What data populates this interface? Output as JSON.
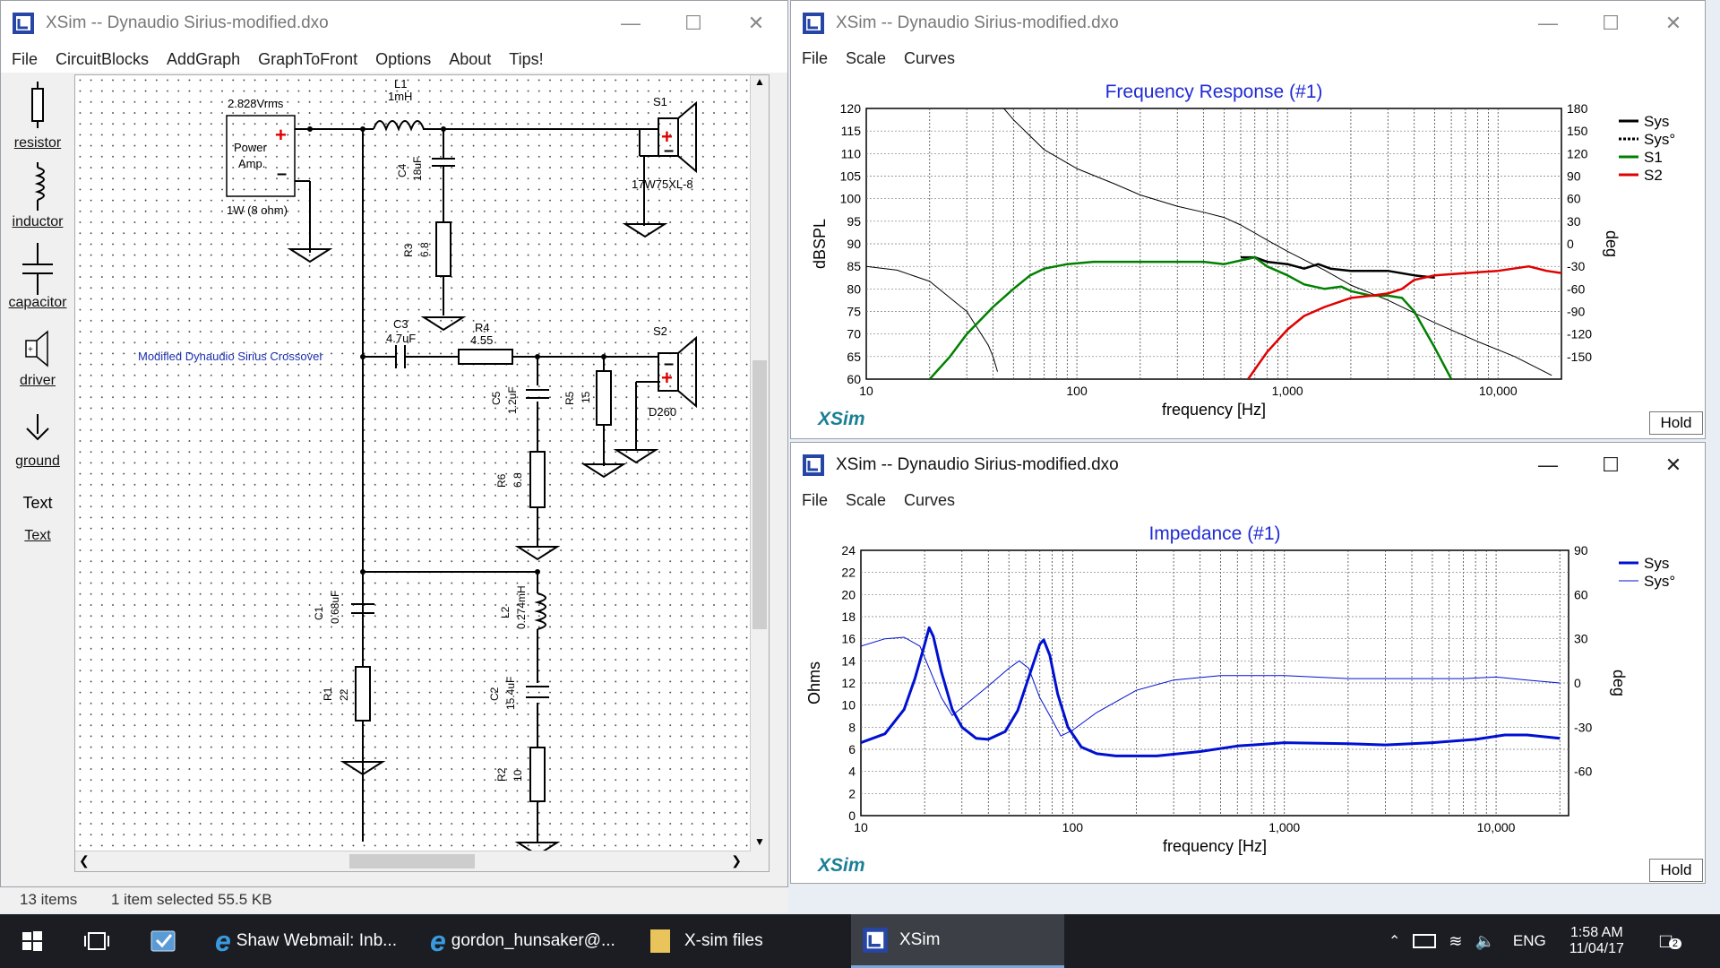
{
  "circuit_window": {
    "title": "XSim -- Dynaudio Sirius-modified.dxo",
    "menu": [
      "File",
      "CircuitBlocks",
      "AddGraph",
      "GraphToFront",
      "Options",
      "About",
      "Tips!"
    ],
    "toolbox": [
      "resistor",
      "inductor",
      "capacitor",
      "driver",
      "ground",
      "Text"
    ],
    "toolbox_text_glyph": "Text",
    "schematic": {
      "amp_voltage": "2.828Vrms",
      "amp_label_1": "Power",
      "amp_label_2": "Amp.",
      "amp_power": "1W (8 ohm)",
      "crossover_title": "Modified Dynaudio Sirius Crossover",
      "L1_name": "L1",
      "L1_value": "1mH",
      "C4_name": "C4",
      "C4_value": "18uF",
      "R3_name": "R3",
      "R3_value": "6.8",
      "S1_name": "S1",
      "S1_model": "17W75XL-8",
      "C3_name": "C3",
      "C3_value": "4.7uF",
      "R4_name": "R4",
      "R4_value": "4.55",
      "C5_name": "C5",
      "C5_value": "1.2uF",
      "R5_name": "R5",
      "R5_value": "15",
      "R6_name": "R6",
      "R6_value": "6.8",
      "S2_name": "S2",
      "S2_model": "D260",
      "C1_name": "C1",
      "C1_value": "0.68uF",
      "R1_name": "R1",
      "R1_value": "22",
      "L2_name": "L2",
      "L2_value": "0.274mH",
      "C2_name": "C2",
      "C2_value": "15.4uF",
      "R2_name": "R2",
      "R2_value": "10"
    }
  },
  "status_bar": {
    "items": "13 items",
    "selected": "1 item selected  55.5 KB"
  },
  "freq_window": {
    "title": "XSim -- Dynaudio Sirius-modified.dxo",
    "menu": [
      "File",
      "Scale",
      "Curves"
    ],
    "hold": "Hold",
    "brand": "XSim"
  },
  "imp_window": {
    "title": "XSim -- Dynaudio Sirius-modified.dxo",
    "menu": [
      "File",
      "Scale",
      "Curves"
    ],
    "hold": "Hold",
    "brand": "XSim"
  },
  "chart_data": [
    {
      "type": "line",
      "title": "Frequency Response (#1)",
      "xlabel": "frequency [Hz]",
      "ylabel": "dBSPL",
      "y2label": "deg",
      "xscale": "log",
      "xlim": [
        10,
        20000
      ],
      "ylim": [
        60,
        120
      ],
      "y2lim": [
        -180,
        180
      ],
      "xticks": [
        "10",
        "100",
        "1,000",
        "10,000"
      ],
      "yticks": [
        "60",
        "65",
        "70",
        "75",
        "80",
        "85",
        "90",
        "95",
        "100",
        "105",
        "110",
        "115",
        "120"
      ],
      "y2ticks": [
        "-150",
        "-120",
        "-90",
        "-60",
        "-30",
        "0",
        "30",
        "60",
        "90",
        "120",
        "150",
        "180"
      ],
      "grid": true,
      "legend_position": "top-right",
      "series": [
        {
          "name": "Sys",
          "color": "#000000",
          "style": "solid",
          "axis": "left",
          "points": [
            [
              600,
              87
            ],
            [
              700,
              87
            ],
            [
              800,
              86
            ],
            [
              1000,
              85.5
            ],
            [
              1200,
              84.5
            ],
            [
              1400,
              85.5
            ],
            [
              1600,
              84.5
            ],
            [
              2000,
              84
            ],
            [
              3000,
              84
            ],
            [
              4000,
              83
            ],
            [
              5000,
              82.5
            ]
          ]
        },
        {
          "name": "Sys°",
          "color": "#000000",
          "style": "dashed",
          "axis": "right",
          "points": [
            [
              10,
              -30
            ],
            [
              14,
              -35
            ],
            [
              20,
              -50
            ],
            [
              30,
              -90
            ],
            [
              38,
              -135
            ],
            [
              40,
              -150
            ],
            [
              42,
              -170
            ],
            [
              45,
              180
            ],
            [
              50,
              165
            ],
            [
              70,
              125
            ],
            [
              100,
              100
            ],
            [
              150,
              80
            ],
            [
              200,
              65
            ],
            [
              300,
              50
            ],
            [
              400,
              42
            ],
            [
              500,
              35
            ],
            [
              600,
              25
            ],
            [
              800,
              5
            ],
            [
              1000,
              -10
            ],
            [
              1500,
              -35
            ],
            [
              2000,
              -55
            ],
            [
              3000,
              -75
            ],
            [
              5000,
              -105
            ],
            [
              8000,
              -130
            ],
            [
              12000,
              -150
            ],
            [
              18000,
              -175
            ]
          ]
        },
        {
          "name": "S1",
          "color": "#008000",
          "style": "solid",
          "axis": "left",
          "points": [
            [
              20,
              60
            ],
            [
              25,
              65
            ],
            [
              30,
              70
            ],
            [
              40,
              76
            ],
            [
              50,
              80
            ],
            [
              60,
              83
            ],
            [
              70,
              84.5
            ],
            [
              90,
              85.5
            ],
            [
              120,
              86
            ],
            [
              200,
              86
            ],
            [
              400,
              86
            ],
            [
              500,
              85.5
            ],
            [
              700,
              87
            ],
            [
              800,
              85
            ],
            [
              1000,
              83
            ],
            [
              1200,
              81
            ],
            [
              1500,
              80
            ],
            [
              1800,
              80.5
            ],
            [
              2000,
              79.5
            ],
            [
              2500,
              78.5
            ],
            [
              3000,
              78.5
            ],
            [
              3500,
              78
            ],
            [
              4000,
              75
            ],
            [
              5000,
              67
            ],
            [
              6000,
              60
            ]
          ]
        },
        {
          "name": "S2",
          "color": "#e00000",
          "style": "solid",
          "axis": "left",
          "points": [
            [
              650,
              60
            ],
            [
              800,
              66
            ],
            [
              1000,
              71
            ],
            [
              1200,
              74
            ],
            [
              1500,
              76
            ],
            [
              2000,
              78
            ],
            [
              2500,
              78.5
            ],
            [
              3000,
              79
            ],
            [
              3500,
              80
            ],
            [
              4000,
              82
            ],
            [
              5000,
              83
            ],
            [
              7000,
              83.5
            ],
            [
              10000,
              84
            ],
            [
              14000,
              85
            ],
            [
              17000,
              84
            ],
            [
              20000,
              83.5
            ]
          ]
        }
      ]
    },
    {
      "type": "line",
      "title": "Impedance (#1)",
      "xlabel": "frequency [Hz]",
      "ylabel": "Ohms",
      "y2label": "deg",
      "xscale": "log",
      "xlim": [
        10,
        22000
      ],
      "ylim": [
        0,
        24
      ],
      "y2lim": [
        -90,
        90
      ],
      "xticks": [
        "10",
        "100",
        "1,000",
        "10,000"
      ],
      "yticks": [
        "0",
        "2",
        "4",
        "6",
        "8",
        "10",
        "12",
        "14",
        "16",
        "18",
        "20",
        "22",
        "24"
      ],
      "y2ticks": [
        "-60",
        "-30",
        "0",
        "30",
        "60",
        "90"
      ],
      "grid": true,
      "legend_position": "top-right",
      "series": [
        {
          "name": "Sys",
          "color": "#0010d0",
          "style": "solid",
          "width": 3,
          "axis": "left",
          "points": [
            [
              10,
              6.6
            ],
            [
              13,
              7.4
            ],
            [
              16,
              9.6
            ],
            [
              18,
              12.4
            ],
            [
              20,
              15.5
            ],
            [
              21,
              17
            ],
            [
              22,
              16.2
            ],
            [
              24,
              13
            ],
            [
              27,
              9.6
            ],
            [
              30,
              8
            ],
            [
              35,
              7
            ],
            [
              40,
              6.9
            ],
            [
              48,
              7.6
            ],
            [
              55,
              9.5
            ],
            [
              62,
              12.5
            ],
            [
              70,
              15.5
            ],
            [
              73,
              15.9
            ],
            [
              78,
              14.5
            ],
            [
              85,
              11
            ],
            [
              95,
              8
            ],
            [
              110,
              6.2
            ],
            [
              130,
              5.6
            ],
            [
              160,
              5.4
            ],
            [
              250,
              5.4
            ],
            [
              400,
              5.8
            ],
            [
              600,
              6.3
            ],
            [
              1000,
              6.6
            ],
            [
              2000,
              6.5
            ],
            [
              3000,
              6.4
            ],
            [
              5000,
              6.6
            ],
            [
              8000,
              6.9
            ],
            [
              11000,
              7.3
            ],
            [
              14000,
              7.3
            ],
            [
              20000,
              7
            ]
          ]
        },
        {
          "name": "Sys°",
          "color": "#0010d0",
          "style": "solid",
          "width": 1,
          "axis": "right",
          "points": [
            [
              10,
              25
            ],
            [
              13,
              30
            ],
            [
              16,
              31
            ],
            [
              19,
              25
            ],
            [
              21,
              10
            ],
            [
              24,
              -10
            ],
            [
              27,
              -22
            ],
            [
              31,
              -15
            ],
            [
              40,
              -2
            ],
            [
              50,
              10
            ],
            [
              56,
              15
            ],
            [
              62,
              10
            ],
            [
              70,
              -10
            ],
            [
              80,
              -25
            ],
            [
              88,
              -36
            ],
            [
              100,
              -32
            ],
            [
              130,
              -20
            ],
            [
              200,
              -5
            ],
            [
              300,
              2
            ],
            [
              500,
              5
            ],
            [
              1000,
              5
            ],
            [
              2000,
              3
            ],
            [
              4000,
              3
            ],
            [
              7000,
              3
            ],
            [
              10000,
              4
            ],
            [
              14000,
              2
            ],
            [
              20000,
              0
            ]
          ]
        }
      ]
    }
  ],
  "taskbar": {
    "items": [
      {
        "label": "Shaw Webmail: Inb..."
      },
      {
        "label": "gordon_hunsaker@..."
      },
      {
        "label": "X-sim files"
      },
      {
        "label": "XSim"
      }
    ],
    "lang": "ENG",
    "time": "1:58 AM",
    "date": "11/04/17",
    "notif_count": "2"
  }
}
